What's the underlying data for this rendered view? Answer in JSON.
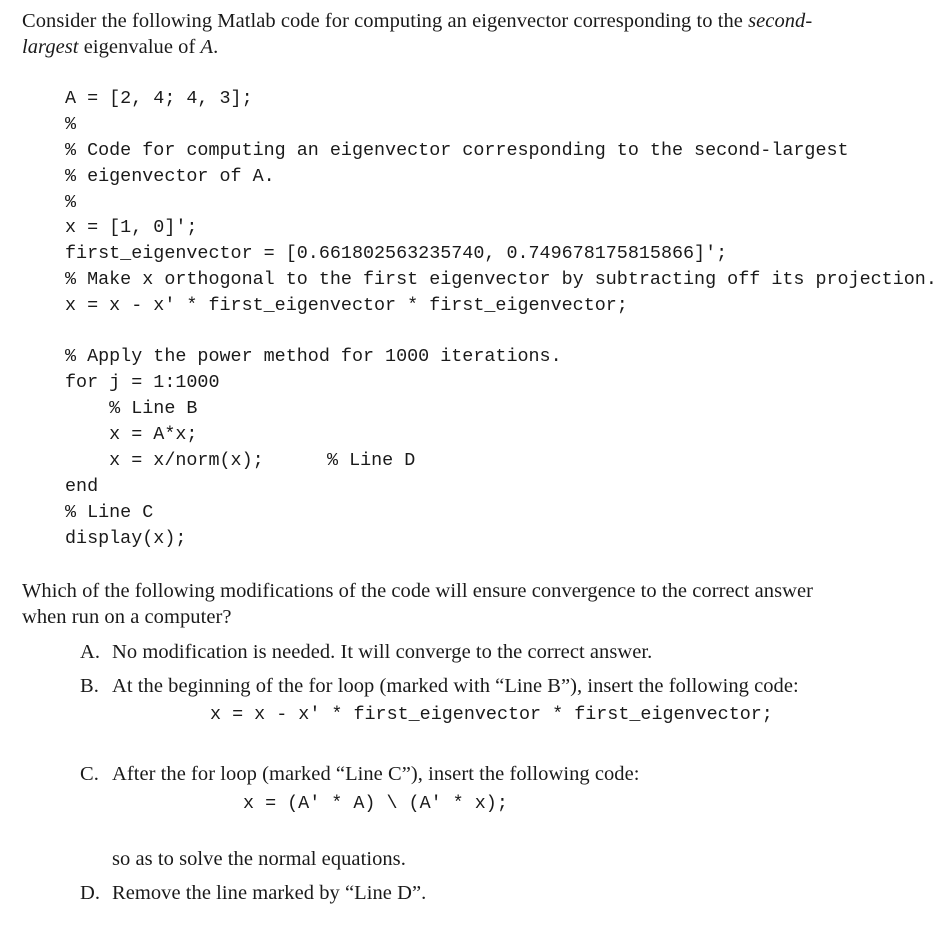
{
  "intro": {
    "line1_before": "Consider the following Matlab code for computing an eigenvector corresponding to the ",
    "line1_italic": "second-",
    "line2_italic": "largest",
    "line2_mid": " eigenvalue of ",
    "line2_var": "A",
    "line2_end": "."
  },
  "code": {
    "lines": [
      "A = [2, 4; 4, 3];",
      "%",
      "% Code for computing an eigenvector corresponding to the second-largest",
      "% eigenvector of A.",
      "%",
      "x = [1, 0]';",
      "first_eigenvector = [0.661802563235740, 0.749678175815866]';",
      "% Make x orthogonal to the first eigenvector by subtracting off its projection.",
      "x = x - x' * first_eigenvector * first_eigenvector;",
      "",
      "% Apply the power method for 1000 iterations.",
      "for j = 1:1000",
      "    % Line B",
      "    x = A*x;",
      "    x = x/norm(x);",
      "end",
      "% Line C",
      "display(x);"
    ],
    "line_d_comment": "% Line D"
  },
  "question": {
    "line1": "Which of the following modifications of the code will ensure convergence to the correct answer",
    "line2": "when run on a computer?"
  },
  "options": [
    {
      "letter": "A.",
      "text": "No modification is needed. It will converge to the correct answer."
    },
    {
      "letter": "B.",
      "text": "At the beginning of the for loop (marked with “Line B”), insert the following code:",
      "code": "x = x - x' * first_eigenvector * first_eigenvector;"
    },
    {
      "letter": "C.",
      "text": "After the for loop (marked “Line C”), insert the following code:",
      "code": "x = (A' * A) \\ (A' * x);",
      "after": "so as to solve the normal equations."
    },
    {
      "letter": "D.",
      "text": "Remove the line marked by “Line D”."
    }
  ]
}
